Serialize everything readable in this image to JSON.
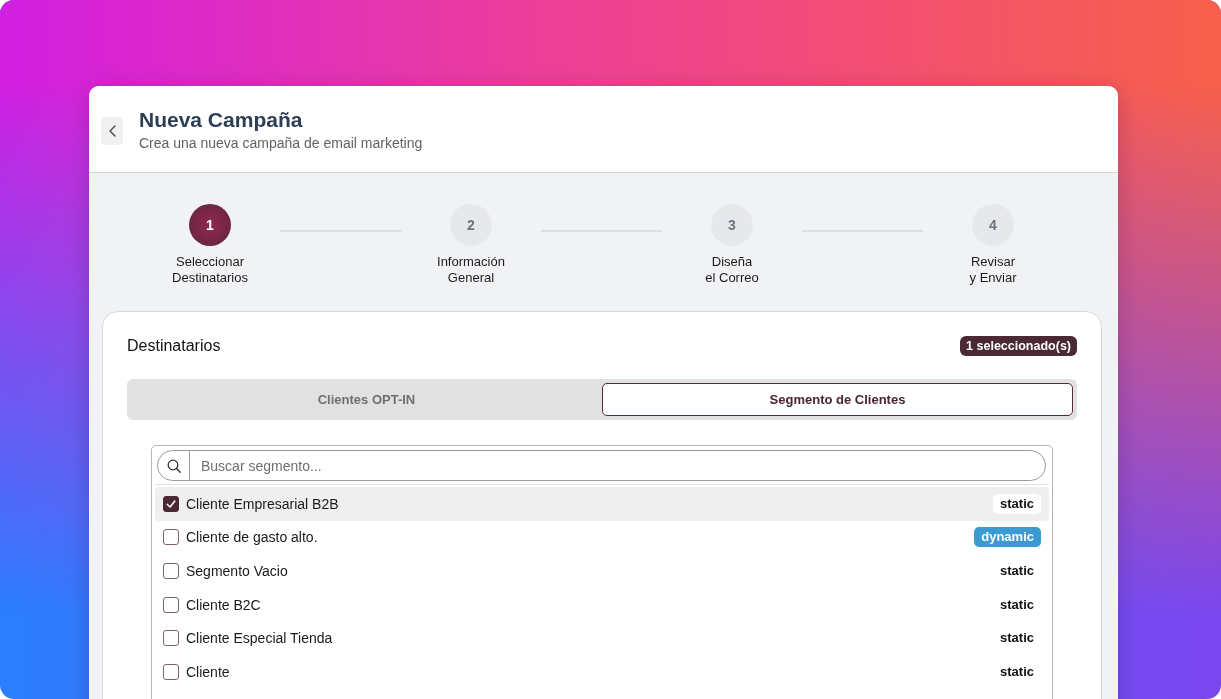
{
  "header": {
    "title": "Nueva Campaña",
    "subtitle": "Crea una nueva campaña de email marketing"
  },
  "steps": [
    {
      "number": "1",
      "label": "Seleccionar\nDestinatarios",
      "selected": true
    },
    {
      "number": "2",
      "label": "Información\nGeneral",
      "selected": false
    },
    {
      "number": "3",
      "label": "Diseña\nel Correo",
      "selected": false
    },
    {
      "number": "4",
      "label": "Revisar\ny Enviar",
      "selected": false
    }
  ],
  "recipients": {
    "title": "Destinatarios",
    "count_badge": "1 seleccionado(s)",
    "tabs": [
      {
        "label": "Clientes OPT-IN",
        "selected": false
      },
      {
        "label": "Segmento de Clientes",
        "selected": true
      }
    ],
    "search": {
      "placeholder": "Buscar segmento..."
    },
    "segments": [
      {
        "name": "Cliente Empresarial B2B",
        "checked": true,
        "selected": true,
        "kind": "static",
        "tag": "static"
      },
      {
        "name": "Cliente de gasto alto.",
        "checked": false,
        "selected": false,
        "kind": "dynamic",
        "tag": "dynamic"
      },
      {
        "name": "Segmento Vacio",
        "checked": false,
        "selected": false,
        "kind": "static",
        "tag": "static"
      },
      {
        "name": "Cliente B2C",
        "checked": false,
        "selected": false,
        "kind": "static",
        "tag": "static"
      },
      {
        "name": "Cliente Especial Tienda",
        "checked": false,
        "selected": false,
        "kind": "static",
        "tag": "static"
      },
      {
        "name": "Cliente",
        "checked": false,
        "selected": false,
        "kind": "static",
        "tag": "static"
      }
    ]
  }
}
